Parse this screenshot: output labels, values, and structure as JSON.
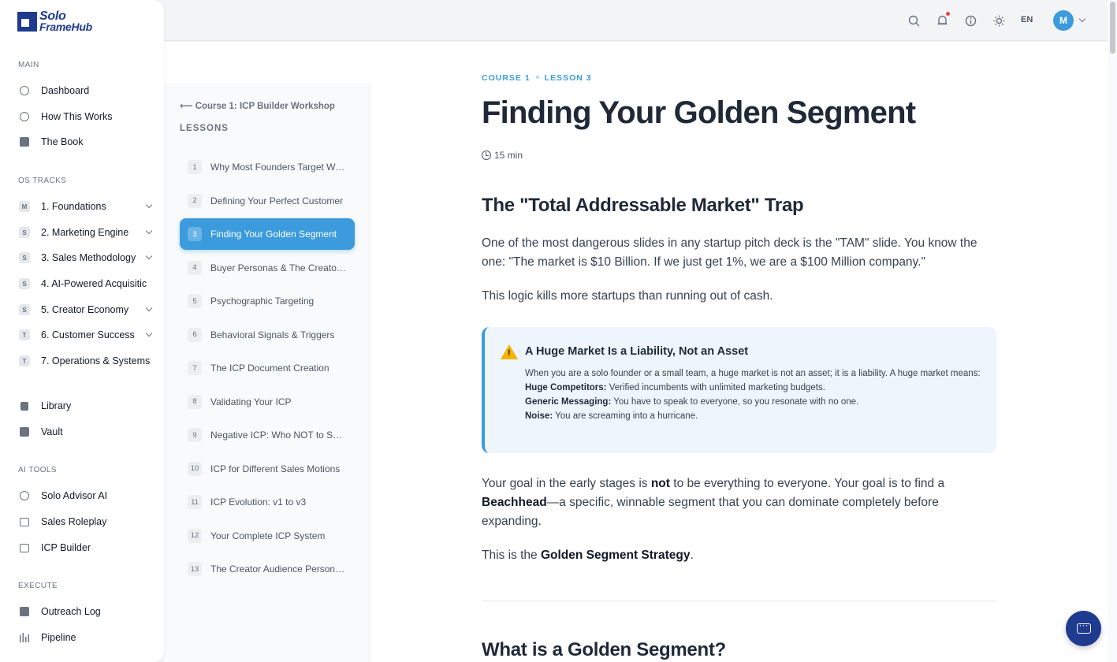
{
  "brand": {
    "line1": "Solo",
    "line2": "FrameHub"
  },
  "sidebar": {
    "main_label": "MAIN",
    "main_items": [
      {
        "label": "Dashboard",
        "icon": "clock-icon"
      },
      {
        "label": "How This Works",
        "icon": "info-icon"
      },
      {
        "label": "The Book",
        "icon": "book-icon"
      }
    ],
    "tracks_label": "OS TRACKS",
    "tracks": [
      {
        "badge": "M",
        "label": "1. Foundations"
      },
      {
        "badge": "S",
        "label": "2. Marketing Engine"
      },
      {
        "badge": "S",
        "label": "3. Sales Methodology"
      },
      {
        "badge": "S",
        "label": "4. AI-Powered Acquisitic"
      },
      {
        "badge": "S",
        "label": "5. Creator Economy"
      },
      {
        "badge": "T",
        "label": "6. Customer Success"
      },
      {
        "badge": "T",
        "label": "7. Operations & Systems"
      }
    ],
    "library_items": [
      {
        "label": "Library",
        "icon": "library-icon"
      },
      {
        "label": "Vault",
        "icon": "vault-icon"
      }
    ],
    "ai_label": "AI TOOLS",
    "ai_items": [
      {
        "label": "Solo Advisor AI",
        "icon": "advisor-icon"
      },
      {
        "label": "Sales Roleplay",
        "icon": "monitor-icon"
      },
      {
        "label": "ICP Builder",
        "icon": "document-icon"
      }
    ],
    "execute_label": "EXECUTE",
    "execute_items": [
      {
        "label": "Outreach Log",
        "icon": "mail-icon"
      },
      {
        "label": "Pipeline",
        "icon": "bars-icon"
      }
    ]
  },
  "topbar": {
    "language": "EN",
    "avatar_initial": "M"
  },
  "lessons_panel": {
    "back_label": "Course 1: ICP Builder Workshop",
    "heading": "LESSONS",
    "active_index": 3,
    "items": [
      {
        "num": "1",
        "title": "Why Most Founders Target Wrong"
      },
      {
        "num": "2",
        "title": "Defining Your Perfect Customer"
      },
      {
        "num": "3",
        "title": "Finding Your Golden Segment"
      },
      {
        "num": "4",
        "title": "Buyer Personas & The Creator Audience"
      },
      {
        "num": "5",
        "title": "Psychographic Targeting"
      },
      {
        "num": "6",
        "title": "Behavioral Signals & Triggers"
      },
      {
        "num": "7",
        "title": "The ICP Document Creation"
      },
      {
        "num": "8",
        "title": "Validating Your ICP"
      },
      {
        "num": "9",
        "title": "Negative ICP: Who NOT to Sell To"
      },
      {
        "num": "10",
        "title": "ICP for Different Sales Motions"
      },
      {
        "num": "11",
        "title": "ICP Evolution: v1 to v3"
      },
      {
        "num": "12",
        "title": "Your Complete ICP System"
      },
      {
        "num": "13",
        "title": "The Creator Audience Persona Map"
      }
    ]
  },
  "article": {
    "crumb_course": "COURSE 1",
    "crumb_lesson": "LESSON 3",
    "title": "Finding Your Golden Segment",
    "duration": "15 min",
    "section1_title": "The \"Total Addressable Market\" Trap",
    "p1": "One of the most dangerous slides in any startup pitch deck is the \"TAM\" slide. You know the one: \"The market is $10 Billion. If we just get 1%, we are a $100 Million company.\"",
    "p2": "This logic kills more startups than running out of cash.",
    "callout": {
      "title": "A Huge Market Is a Liability, Not an Asset",
      "intro": "When you are a solo founder or a small team, a huge market is not an asset; it is a liability. A huge market means:",
      "b1_label": "Huge Competitors:",
      "b1_text": " Verified incumbents with unlimited marketing budgets.",
      "b2_label": "Generic Messaging:",
      "b2_text": " You have to speak to everyone, so you resonate with no one.",
      "b3_label": "Noise:",
      "b3_text": " You are screaming into a hurricane."
    },
    "p3_a": "Your goal in the early stages is ",
    "p3_b": "not",
    "p3_c": " to be everything to everyone. Your goal is to find a ",
    "p3_d": "Beachhead",
    "p3_e": "—a specific, winnable segment that you can dominate completely before expanding.",
    "p4_a": "This is the ",
    "p4_b": "Golden Segment Strategy",
    "p4_c": ".",
    "section2_title": "What is a Golden Segment?"
  }
}
